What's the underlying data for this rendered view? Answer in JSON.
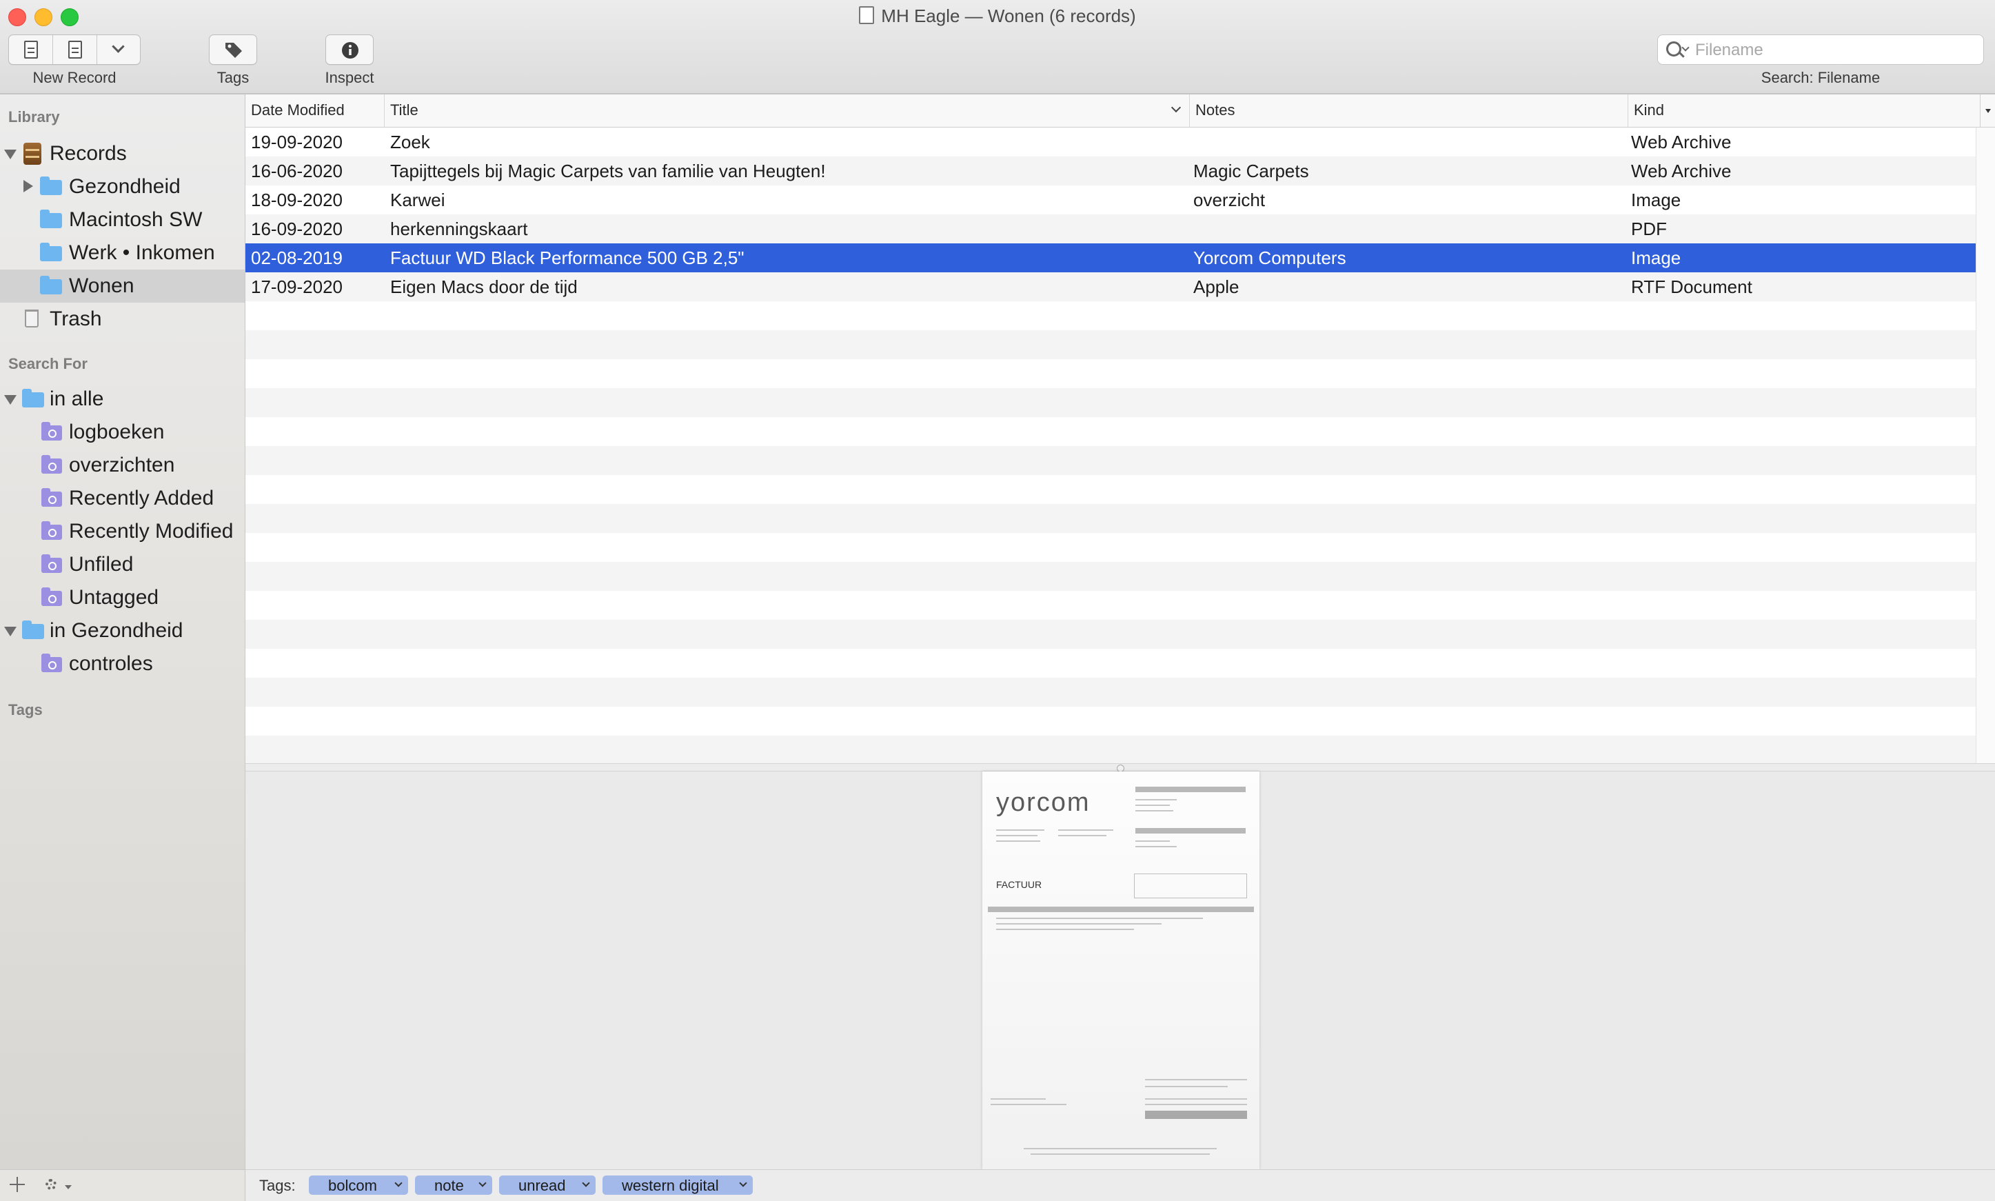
{
  "window": {
    "title": "MH Eagle — Wonen (6 records)"
  },
  "toolbar": {
    "new_record_label": "New Record",
    "tags_label": "Tags",
    "inspect_label": "Inspect"
  },
  "search": {
    "placeholder": "Filename",
    "value": "",
    "scope_label": "Search: Filename"
  },
  "sidebar": {
    "library_heading": "Library",
    "records_label": "Records",
    "folders": [
      "Gezondheid",
      "Macintosh SW",
      "Werk • Inkomen",
      "Wonen"
    ],
    "selected_folder": "Wonen",
    "trash_label": "Trash",
    "search_heading": "Search For",
    "search_groups": [
      {
        "label": "in alle",
        "items": [
          "logboeken",
          "overzichten",
          "Recently Added",
          "Recently Modified",
          "Unfiled",
          "Untagged"
        ]
      },
      {
        "label": "in Gezondheid",
        "items": [
          "controles"
        ]
      }
    ],
    "tags_heading": "Tags"
  },
  "table": {
    "columns": [
      "Date Modified",
      "Title",
      "Notes",
      "Kind"
    ],
    "sorted_column": "Title",
    "rows": [
      {
        "date": "19-09-2020",
        "title": "Zoek",
        "notes": "",
        "kind": "Web Archive"
      },
      {
        "date": "16-06-2020",
        "title": "Tapijttegels bij Magic Carpets van familie van Heugten!",
        "notes": "Magic Carpets",
        "kind": "Web Archive"
      },
      {
        "date": "18-09-2020",
        "title": "Karwei",
        "notes": "overzicht",
        "kind": "Image"
      },
      {
        "date": "16-09-2020",
        "title": "herkenningskaart",
        "notes": "",
        "kind": "PDF"
      },
      {
        "date": "02-08-2019",
        "title": "Factuur WD Black Performance 500 GB 2,5\"",
        "notes": "Yorcom Computers",
        "kind": "Image"
      },
      {
        "date": "17-09-2020",
        "title": "Eigen Macs door de tijd",
        "notes": "Apple",
        "kind": "RTF Document"
      }
    ],
    "selected_row_index": 4
  },
  "preview": {
    "brand": "yorcom",
    "document_heading": "FACTUUR"
  },
  "tagbar": {
    "label": "Tags:",
    "tags": [
      "bolcom",
      "note",
      "unread",
      "western digital"
    ]
  },
  "colors": {
    "selection": "#2f5fdb",
    "folder": "#6db6ef",
    "smart_folder": "#9a8fe0",
    "tag_chip": "#a3b9ea"
  }
}
